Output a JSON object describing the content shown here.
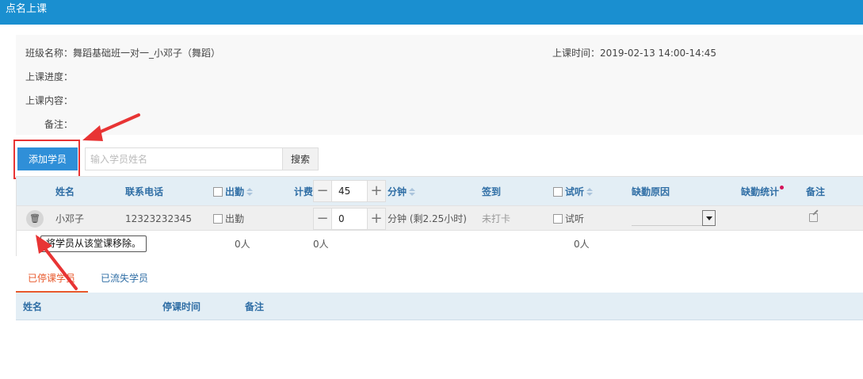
{
  "window": {
    "title": "点名上课"
  },
  "info": {
    "class_name": "班级名称：舞蹈基础班一对一_小邓子（舞蹈）",
    "class_time": "上课时间：2019-02-13    14:00-14:45",
    "progress_label": "上课进度：",
    "content_label": "上课内容：",
    "remark_label": "备注："
  },
  "toolbar": {
    "add_student_label": "添加学员",
    "search_placeholder": "输入学员姓名",
    "search_button_label": "搜索"
  },
  "table": {
    "headers": {
      "name": "姓名",
      "phone": "联系电话",
      "attendance": "出勤",
      "fee": "计费",
      "minutes": "分钟",
      "checkin": "签到",
      "trial": "试听",
      "absence_reason": "缺勤原因",
      "absence_stats": "缺勤统计",
      "remark": "备注"
    },
    "header_fee_value": "45",
    "rows": [
      {
        "name": "小邓子",
        "phone": "12323232345",
        "attendance_label": "出勤",
        "fee_value": "0",
        "minutes_text": "分钟 (剩2.25小时)",
        "checkin_status": "未打卡",
        "trial_label": "试听",
        "absence_reason": ""
      }
    ],
    "footer": {
      "attendance_count": "0人",
      "fee_count": "0人",
      "trial_count": "0人"
    },
    "remove_tooltip": "将学员从该堂课移除。"
  },
  "icons": {
    "trash": "trash-icon",
    "edit": "edit-icon",
    "minus": "−",
    "plus": "+"
  },
  "tabs": [
    {
      "label": "已停课学员",
      "active": true
    },
    {
      "label": "已流失学员",
      "active": false
    }
  ],
  "table2": {
    "headers": {
      "name": "姓名",
      "suspend_time": "停课时间",
      "remark": "备注"
    }
  },
  "colors": {
    "titlebar": "#1a8fd0",
    "primary_button": "#2f8fd8",
    "annotation_red": "#e83434",
    "active_tab": "#e8592c",
    "header_text": "#2f6ea5"
  }
}
